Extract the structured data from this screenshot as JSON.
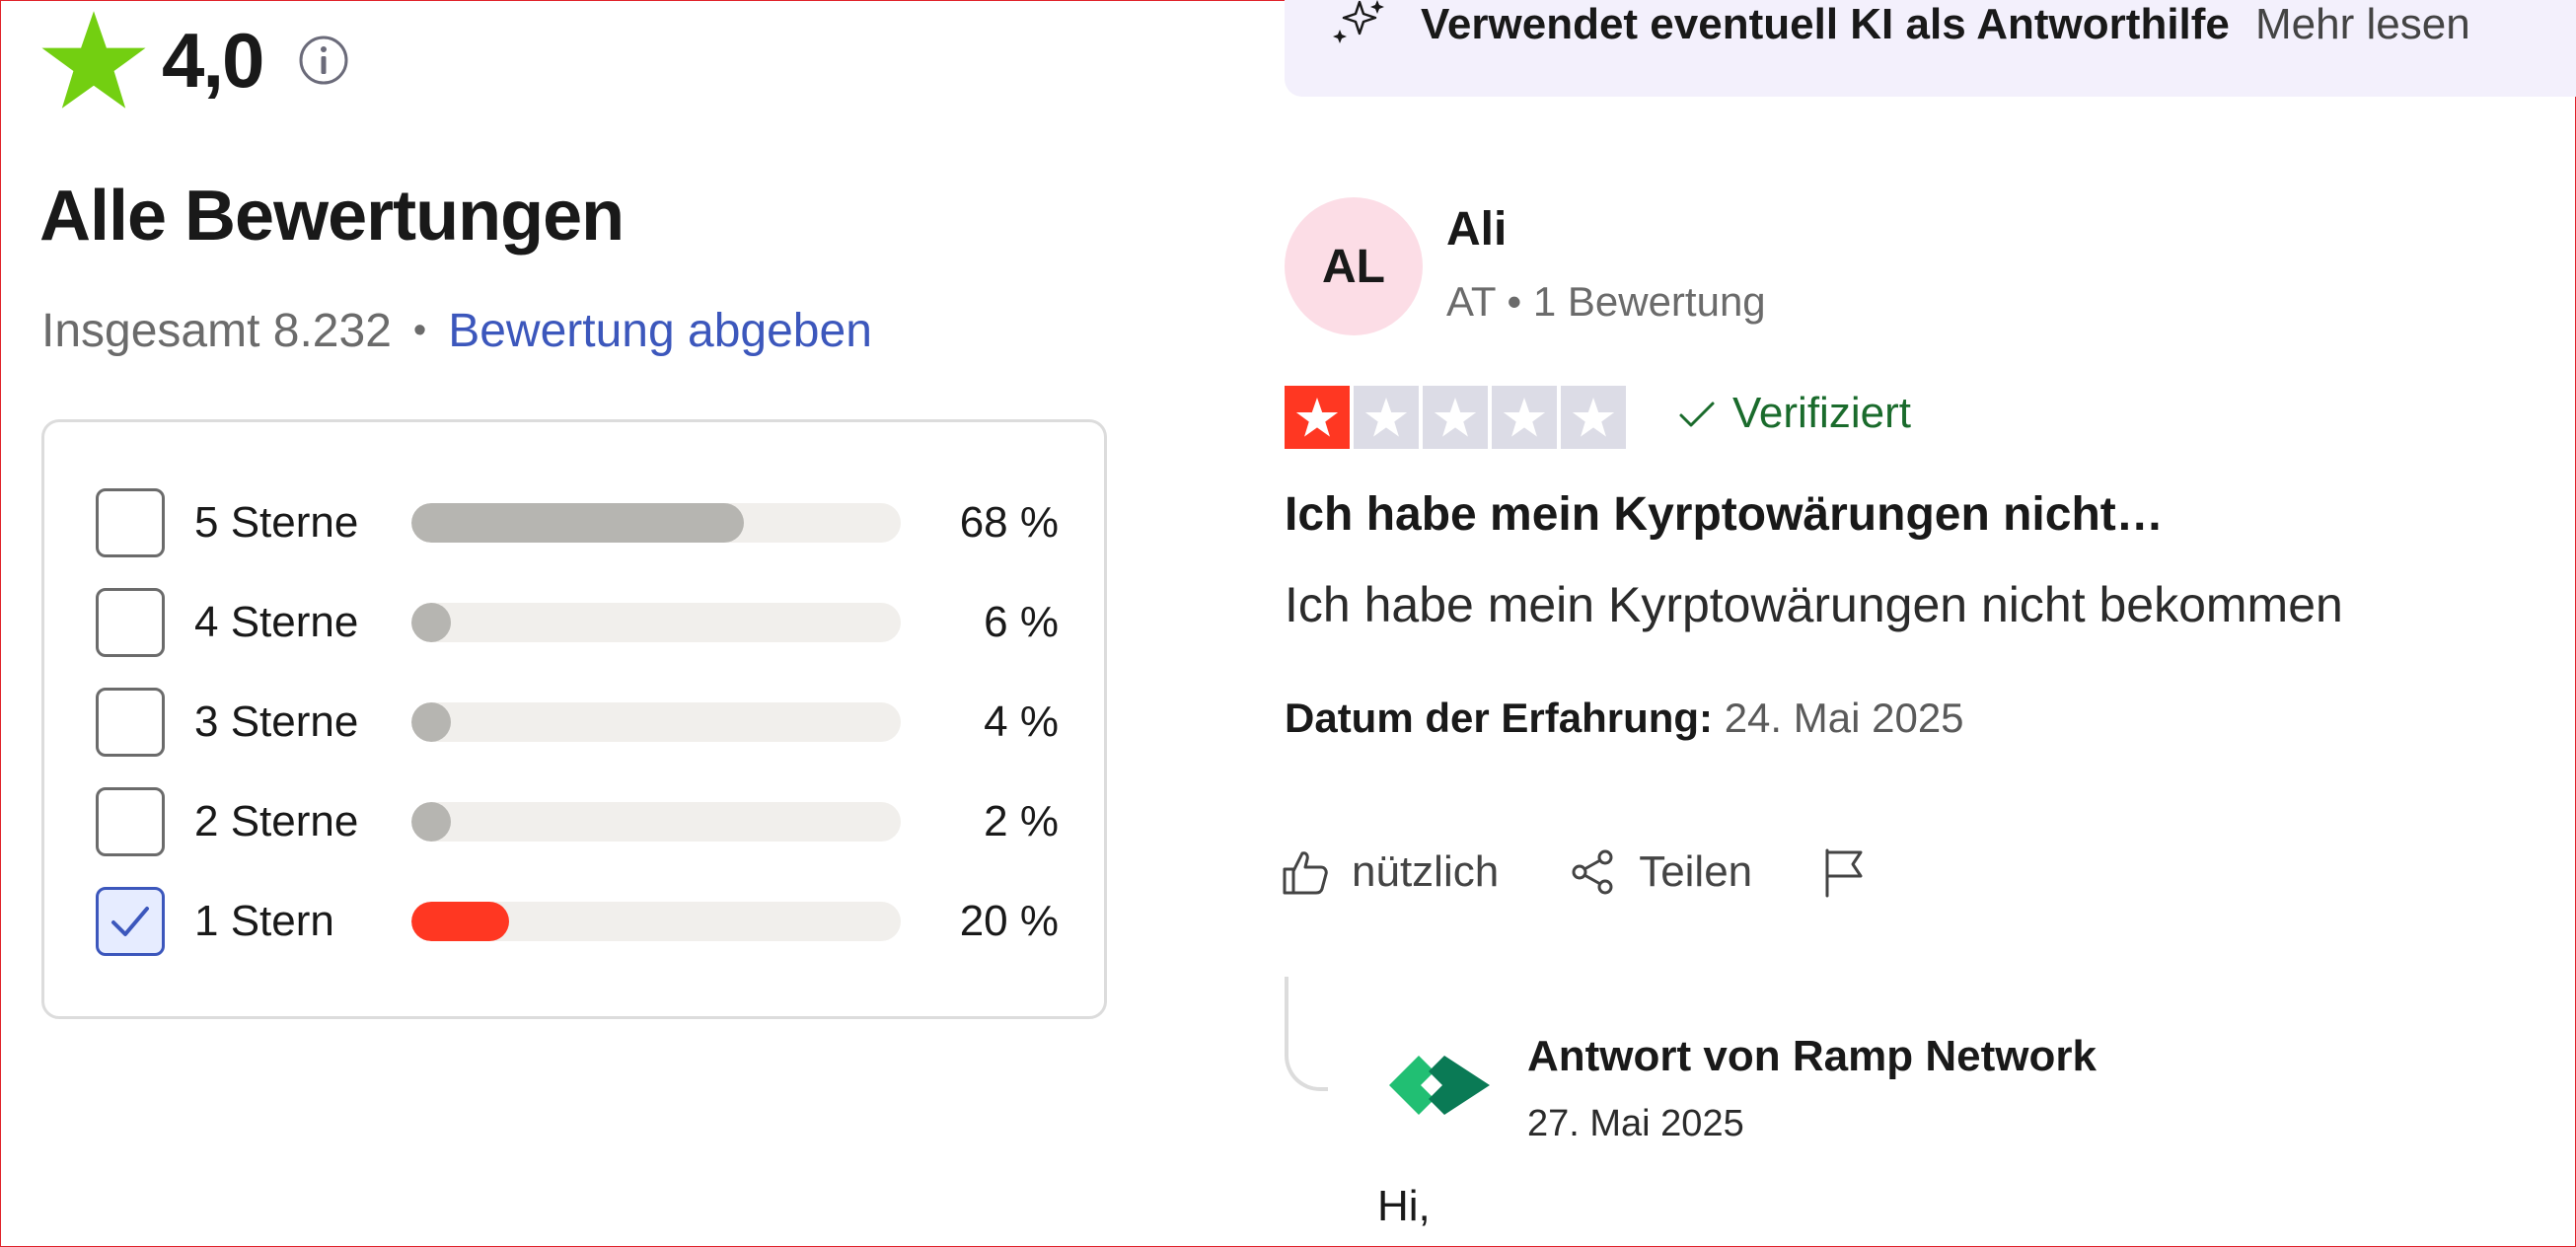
{
  "summary": {
    "score": "4,0",
    "title": "Alle Bewertungen",
    "total": "Insgesamt 8.232",
    "separator": "•",
    "write_review": "Bewertung abgeben"
  },
  "filters": [
    {
      "label": "5 Sterne",
      "percent_text": "68 %",
      "percent": 68,
      "checked": false
    },
    {
      "label": "4 Sterne",
      "percent_text": "6 %",
      "percent": 6,
      "checked": false
    },
    {
      "label": "3 Sterne",
      "percent_text": "4 %",
      "percent": 4,
      "checked": false
    },
    {
      "label": "2 Sterne",
      "percent_text": "2 %",
      "percent": 2,
      "checked": false
    },
    {
      "label": "1 Stern",
      "percent_text": "20 %",
      "percent": 20,
      "checked": true
    }
  ],
  "ai_banner": {
    "text": "Verwendet eventuell KI als Antworthilfe",
    "more": "Mehr lesen"
  },
  "review": {
    "avatar_initials": "AL",
    "author": "Ali",
    "meta": "AT • 1 Bewertung",
    "rating": 1,
    "verified": "Verifiziert",
    "title": "Ich habe mein Kyrptowärungen nicht…",
    "body": "Ich habe mein Kyrptowärungen nicht bekommen",
    "date_label": "Datum der Erfahrung:",
    "date_value": " 24. Mai 2025",
    "useful": "nützlich",
    "share": "Teilen"
  },
  "reply": {
    "from": "Antwort von Ramp Network",
    "date": "27. Mai 2025",
    "text": "Hi,"
  },
  "colors": {
    "brand_star": "#73cf11",
    "link": "#3c57bc",
    "one_star": "#ff3722",
    "verified": "#1a6b2c",
    "ramp_green": "#21bf73",
    "ramp_dark": "#0a7a55"
  },
  "icons": [
    "star-icon",
    "info-icon",
    "sparkles-icon",
    "checkmark-icon",
    "thumbs-up-icon",
    "share-icon",
    "flag-icon",
    "ramp-logo-icon"
  ]
}
